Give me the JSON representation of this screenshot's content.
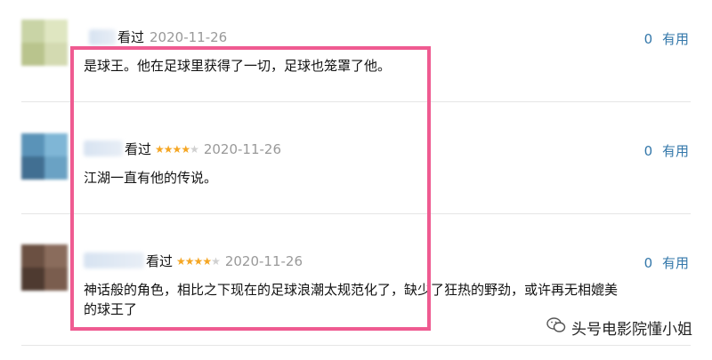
{
  "comments": [
    {
      "status": "看过",
      "rating": 0,
      "date": "2020-11-26",
      "text": "是球王。他在足球里获得了一切，足球也笼罩了他。",
      "useful_count": "0",
      "useful_label": "有用",
      "avatar_colors": [
        "#c9d4a6",
        "#dfe6c1",
        "#b9c48d",
        "#d3dab1"
      ]
    },
    {
      "status": "看过",
      "rating": 4,
      "date": "2020-11-26",
      "text": "江湖一直有他的传说。",
      "useful_count": "0",
      "useful_label": "有用",
      "avatar_colors": [
        "#5a93b8",
        "#7fb6d6",
        "#416f92",
        "#6aa2c4"
      ]
    },
    {
      "status": "看过",
      "rating": 4,
      "date": "2020-11-26",
      "text_line1": "神话般的角色，相比之下现在的足球浪潮太规范化了，缺少了狂热的野劲，或许再无相媲美",
      "text_line2": "的球王了",
      "useful_count": "0",
      "useful_label": "有用",
      "avatar_colors": [
        "#6b5042",
        "#8a6c5c",
        "#4e3a30",
        "#7a5d4e"
      ]
    }
  ],
  "watermark": {
    "text": "头号电影院懂小姐",
    "icon": "wechat-icon"
  },
  "colors": {
    "highlight_border": "#ef5b91",
    "link": "#3377aa",
    "star": "#f5a623",
    "date": "#999999"
  }
}
